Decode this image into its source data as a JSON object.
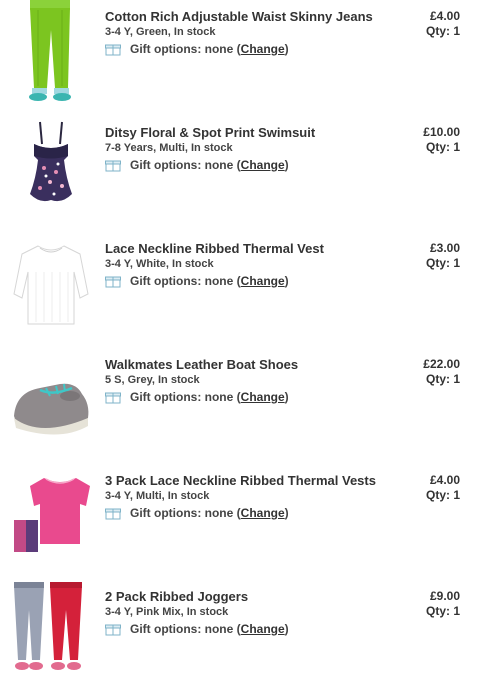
{
  "gift": {
    "prefix": "Gift options: none (",
    "link": "Change",
    "suffix": ")"
  },
  "items": [
    {
      "title": "Cotton Rich Adjustable Waist Skinny Jeans",
      "meta": "3-4 Y, Green, In stock",
      "price": "£4.00",
      "qty": "Qty: 1",
      "image": "green-skinny-jeans"
    },
    {
      "title": "Ditsy Floral & Spot Print Swimsuit",
      "meta": "7-8 Years, Multi, In stock",
      "price": "£10.00",
      "qty": "Qty: 1",
      "image": "floral-swimsuit"
    },
    {
      "title": "Lace Neckline Ribbed Thermal Vest",
      "meta": "3-4 Y, White, In stock",
      "price": "£3.00",
      "qty": "Qty: 1",
      "image": "white-thermal-vest"
    },
    {
      "title": "Walkmates Leather Boat Shoes",
      "meta": "5 S, Grey, In stock",
      "price": "£22.00",
      "qty": "Qty: 1",
      "image": "grey-boat-shoe"
    },
    {
      "title": "3 Pack Lace Neckline Ribbed Thermal Vests",
      "meta": "3-4 Y, Multi, In stock",
      "price": "£4.00",
      "qty": "Qty: 1",
      "image": "pink-thermal-vests"
    },
    {
      "title": "2 Pack Ribbed Joggers",
      "meta": "3-4 Y, Pink Mix, In stock",
      "price": "£9.00",
      "qty": "Qty: 1",
      "image": "ribbed-joggers"
    }
  ]
}
